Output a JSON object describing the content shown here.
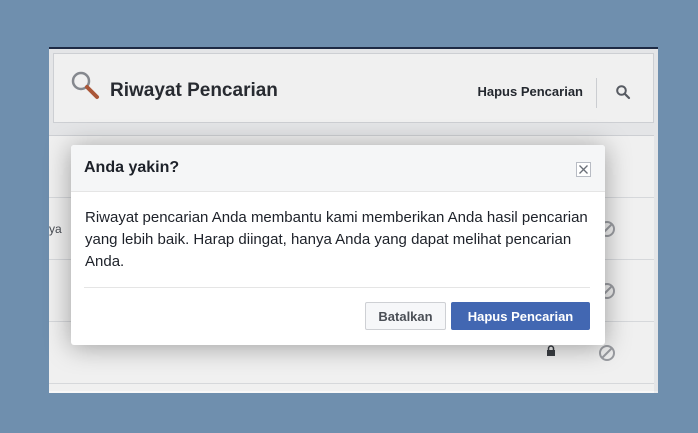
{
  "page": {
    "title": "Riwayat Pencarian",
    "header_clear_label": "Hapus Pencarian",
    "row1_snippet": "ya"
  },
  "dialog": {
    "title": "Anda yakin?",
    "body": "Riwayat pencarian Anda membantu kami memberikan Anda hasil pencarian yang lebih baik. Harap diingat, hanya Anda yang dapat melihat pencarian Anda.",
    "cancel_label": "Batalkan",
    "confirm_label": "Hapus Pencarian"
  },
  "colors": {
    "backdrop": "#6f8fae",
    "primary": "#4267b2",
    "dialog_header_bg": "#f5f6f7"
  },
  "icons": {
    "header_icon": "magnifier-icon",
    "search_button_icon": "search-icon",
    "row_action_icon": "block-icon",
    "privacy_icon": "lock-icon",
    "close_icon": "close-icon"
  }
}
